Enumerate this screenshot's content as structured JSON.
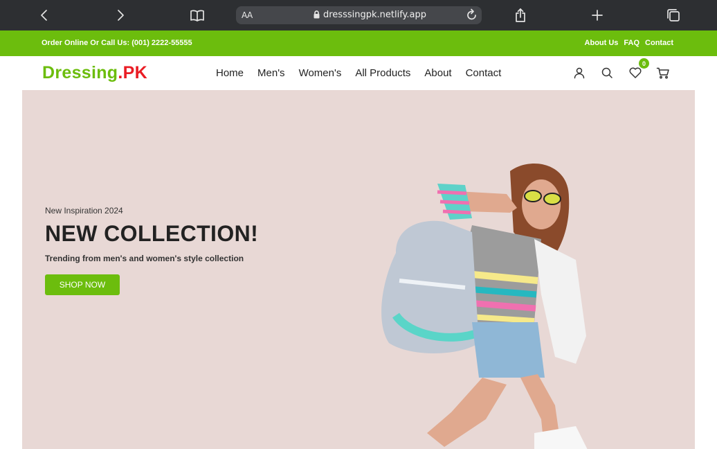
{
  "browser": {
    "text_size_label": "AA",
    "url": "dresssingpk.netlify.app"
  },
  "topbar": {
    "call_text": "Order Online Or Call Us: (001) 2222-55555",
    "links": [
      "About Us",
      "FAQ",
      "Contact"
    ]
  },
  "header": {
    "logo_part1": "Dressing",
    "logo_part2": ".PK",
    "nav": [
      "Home",
      "Men's",
      "Women's",
      "All Products",
      "About",
      "Contact"
    ],
    "wishlist_count": "0"
  },
  "hero": {
    "eyebrow": "New Inspiration 2024",
    "title": "NEW COLLECTION!",
    "subtitle": "Trending from men's and women's style collection",
    "cta": "SHOP NOW"
  },
  "colors": {
    "brand_green": "#6cbd0d",
    "brand_red": "#ea1c24",
    "hero_bg": "#e8d8d5",
    "chrome_bg": "#2d2f32"
  },
  "icons": [
    "back-icon",
    "forward-icon",
    "bookmarks-icon",
    "lock-icon",
    "reload-icon",
    "share-icon",
    "new-tab-icon",
    "tabs-icon",
    "user-icon",
    "search-icon",
    "heart-icon",
    "cart-icon"
  ]
}
